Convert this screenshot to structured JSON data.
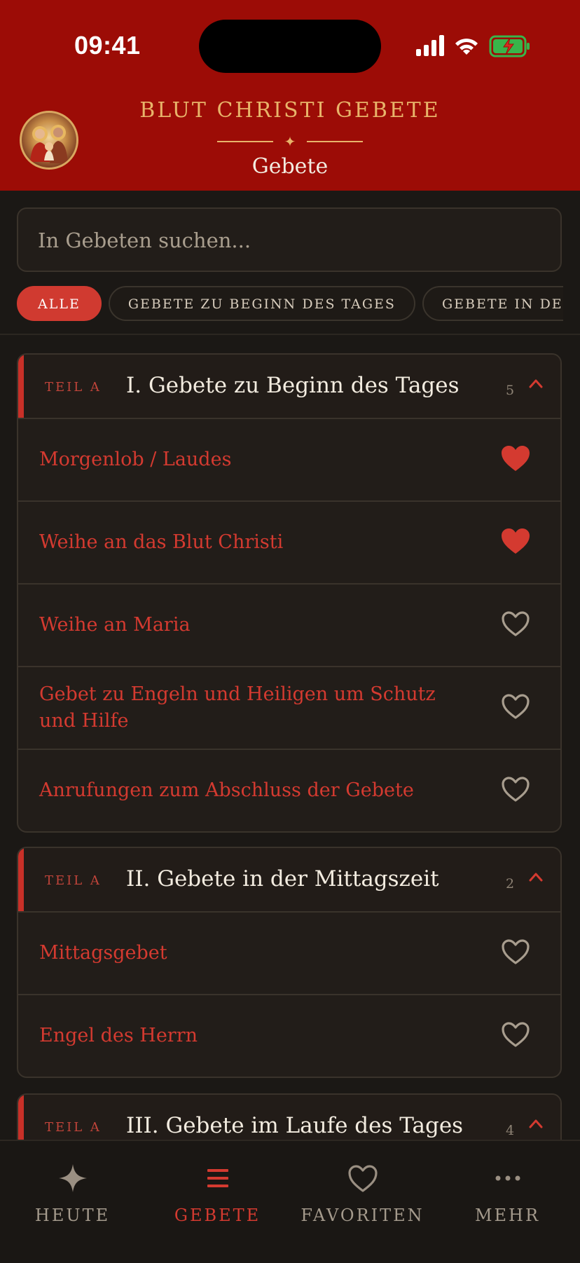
{
  "status_bar": {
    "time": "09:41"
  },
  "header": {
    "app_title": "BLUT CHRISTI GEBETE",
    "page_subtitle": "Gebete"
  },
  "search": {
    "placeholder": "In Gebeten suchen..."
  },
  "filters": [
    {
      "label": "ALLE",
      "active": true
    },
    {
      "label": "GEBETE ZU BEGINN DES TAGES",
      "active": false
    },
    {
      "label": "GEBETE IN DER MITTAGSZEIT",
      "active": false
    }
  ],
  "sections": [
    {
      "part": "TEIL A",
      "title": "I. Gebete zu Beginn des Tages",
      "count": "5",
      "items": [
        {
          "label": "Morgenlob / Laudes",
          "favorite": true
        },
        {
          "label": "Weihe an das Blut Christi",
          "favorite": true
        },
        {
          "label": "Weihe an Maria",
          "favorite": false
        },
        {
          "label": "Gebet zu Engeln und Heiligen um Schutz und Hilfe",
          "favorite": false
        },
        {
          "label": "Anrufungen zum Abschluss der Gebete",
          "favorite": false
        }
      ]
    },
    {
      "part": "TEIL A",
      "title": "II. Gebete in der Mittagszeit",
      "count": "2",
      "items": [
        {
          "label": "Mittagsgebet",
          "favorite": false
        },
        {
          "label": "Engel des Herrn",
          "favorite": false
        }
      ]
    },
    {
      "part": "TEIL A",
      "title": "III. Gebete im Laufe des Tages",
      "count": "4",
      "items": []
    }
  ],
  "bottom_nav": [
    {
      "label": "HEUTE",
      "icon": "sparkle-icon",
      "active": false
    },
    {
      "label": "GEBETE",
      "icon": "list-icon",
      "active": true
    },
    {
      "label": "FAVORITEN",
      "icon": "heart-icon",
      "active": false
    },
    {
      "label": "MEHR",
      "icon": "more-dots-icon",
      "active": false
    }
  ],
  "colors": {
    "header_bg": "#9c0c06",
    "accent": "#d43a30",
    "gold": "#e8b46a",
    "background": "#1b1815"
  }
}
